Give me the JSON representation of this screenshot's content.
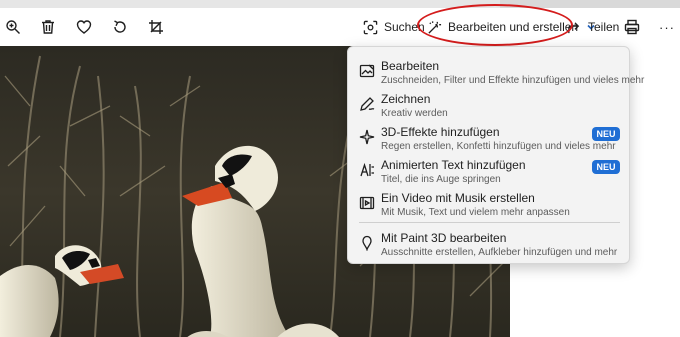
{
  "toolbar": {
    "icons": [
      "zoom-icon",
      "delete-icon",
      "favorite-icon",
      "rotate-icon",
      "crop-icon",
      "print-icon",
      "more-icon"
    ],
    "search_label": "Suchen",
    "edit_create_label": "Bearbeiten und erstellen",
    "share_label": "Teilen",
    "more_label": "···"
  },
  "menu": {
    "items": [
      {
        "title": "Bearbeiten",
        "desc": "Zuschneiden, Filter und Effekte hinzufügen und vieles mehr",
        "icon": "edit-image-icon"
      },
      {
        "title": "Zeichnen",
        "desc": "Kreativ werden",
        "icon": "pen-icon"
      },
      {
        "title": "3D-Effekte hinzufügen",
        "desc": "Regen erstellen, Konfetti hinzufügen und vieles mehr",
        "icon": "sparkle-icon",
        "badge": "NEU"
      },
      {
        "title": "Animierten Text hinzufügen",
        "desc": "Titel, die ins Auge springen",
        "icon": "animated-text-icon",
        "badge": "NEU"
      },
      {
        "title": "Ein Video mit Musik erstellen",
        "desc": "Mit Musik, Text und vielem mehr anpassen",
        "icon": "video-icon"
      },
      {
        "title": "Mit Paint 3D bearbeiten",
        "desc": "Ausschnitte erstellen, Aufkleber hinzufügen und mehr",
        "icon": "paint3d-icon"
      }
    ]
  },
  "colors": {
    "accent": "#1f6ed4",
    "highlight_ring": "#d41c1c",
    "menu_bg": "#f3f3f3"
  }
}
